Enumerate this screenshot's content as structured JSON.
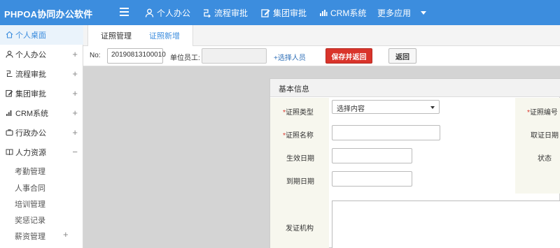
{
  "app": {
    "title": "PHPOA协同办公软件"
  },
  "topnav": [
    {
      "label": "个人办公",
      "icon": "user-icon"
    },
    {
      "label": "流程审批",
      "icon": "flow-icon"
    },
    {
      "label": "集团审批",
      "icon": "edit-icon"
    },
    {
      "label": "CRM系统",
      "icon": "bar-chart-icon"
    },
    {
      "label": "更多应用",
      "icon": "caret-down-icon"
    }
  ],
  "sidebar": {
    "items": [
      {
        "label": "个人桌面",
        "icon": "home-icon",
        "toggle": ""
      },
      {
        "label": "个人办公",
        "icon": "user-icon",
        "toggle": "+"
      },
      {
        "label": "流程审批",
        "icon": "flow-icon",
        "toggle": "+"
      },
      {
        "label": "集团审批",
        "icon": "edit-icon",
        "toggle": "+"
      },
      {
        "label": "CRM系统",
        "icon": "bar-chart-icon",
        "toggle": "+"
      },
      {
        "label": "行政办公",
        "icon": "briefcase-icon",
        "toggle": "+"
      },
      {
        "label": "人力资源",
        "icon": "book-icon",
        "toggle": "−"
      }
    ],
    "subitems": [
      {
        "label": "考勤管理"
      },
      {
        "label": "人事合同"
      },
      {
        "label": "培训管理"
      },
      {
        "label": "奖惩记录"
      },
      {
        "label": "薪资管理",
        "toggle": "+"
      }
    ]
  },
  "tabs": [
    {
      "label": "证照管理"
    },
    {
      "label": "证照新增"
    }
  ],
  "toolbar": {
    "no_label": "No:",
    "no_value": "20190813100010",
    "employee_label": "单位员工:",
    "employee_value": "",
    "select_person_link": "+选择人员",
    "save_return_button": "保存并返回",
    "return_button": "返回"
  },
  "form": {
    "section_title": "基本信息",
    "license_type_label": "证照类型",
    "license_type_value": "选择内容",
    "license_name_label": "证照名称",
    "license_name_value": "",
    "effective_date_label": "生效日期",
    "effective_date_value": "",
    "expiry_date_label": "到期日期",
    "expiry_date_value": "",
    "issuing_authority_label": "发证机构",
    "license_number_label": "证照编号",
    "obtain_date_label": "取证日期",
    "status_label": "状态",
    "required_mark": "*"
  },
  "colors": {
    "topbar": "#3c8dde",
    "accent": "#3c8dde",
    "danger_button": "#d9342b",
    "required": "#d9342b"
  }
}
